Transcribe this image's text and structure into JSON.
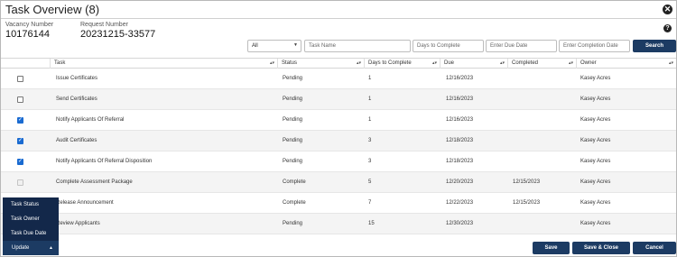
{
  "title": "Task Overview (8)",
  "meta": {
    "vacancy_label": "Vacancy Number",
    "vacancy_value": "10176144",
    "request_label": "Request Number",
    "request_value": "20231215-33577"
  },
  "filters": {
    "status_value": "All",
    "task_placeholder": "Task Name",
    "days_placeholder": "Days to Complete",
    "due_placeholder": "Enter Due Date",
    "completion_placeholder": "Enter Completion Date",
    "search_label": "Search"
  },
  "columns": [
    "Task",
    "Status",
    "Days to Complete",
    "Due",
    "Completed",
    "Owner"
  ],
  "rows": [
    {
      "checkbox": "unchecked",
      "task": "Issue Certificates",
      "status": "Pending",
      "days": "1",
      "due": "12/16/2023",
      "completed": "",
      "owner": "Kasey Acres"
    },
    {
      "checkbox": "unchecked",
      "task": "Send Certificates",
      "status": "Pending",
      "days": "1",
      "due": "12/16/2023",
      "completed": "",
      "owner": "Kasey Acres"
    },
    {
      "checkbox": "checked",
      "task": "Notify Applicants Of Referral",
      "status": "Pending",
      "days": "1",
      "due": "12/16/2023",
      "completed": "",
      "owner": "Kasey Acres"
    },
    {
      "checkbox": "checked",
      "task": "Audit Certificates",
      "status": "Pending",
      "days": "3",
      "due": "12/18/2023",
      "completed": "",
      "owner": "Kasey Acres"
    },
    {
      "checkbox": "checked",
      "task": "Notify Applicants Of Referral Disposition",
      "status": "Pending",
      "days": "3",
      "due": "12/18/2023",
      "completed": "",
      "owner": "Kasey Acres"
    },
    {
      "checkbox": "disabled",
      "task": "Complete Assessment Package",
      "status": "Complete",
      "days": "5",
      "due": "12/20/2023",
      "completed": "12/15/2023",
      "owner": "Kasey Acres"
    },
    {
      "checkbox": "hidden",
      "task": "Release Announcement",
      "status": "Complete",
      "days": "7",
      "due": "12/22/2023",
      "completed": "12/15/2023",
      "owner": "Kasey Acres"
    },
    {
      "checkbox": "hidden",
      "task": "Review Applicants",
      "status": "Pending",
      "days": "15",
      "due": "12/30/2023",
      "completed": "",
      "owner": "Kasey Acres"
    }
  ],
  "update_menu": {
    "items": [
      "Task Status",
      "Task Owner",
      "Task Due Date"
    ],
    "button_label": "Update"
  },
  "footer": {
    "save": "Save",
    "save_close": "Save & Close",
    "cancel": "Cancel"
  },
  "colors": {
    "primary_button": "#1c3b63",
    "menu_bg": "#13284a",
    "checkbox_checked": "#1a6bd1",
    "row_alt": "#f4f4f4"
  },
  "icons": {
    "close": "close-icon",
    "help": "help-icon",
    "sort": "sort-icon",
    "dropdown": "chevron-down-icon",
    "update_caret": "caret-up-icon"
  }
}
